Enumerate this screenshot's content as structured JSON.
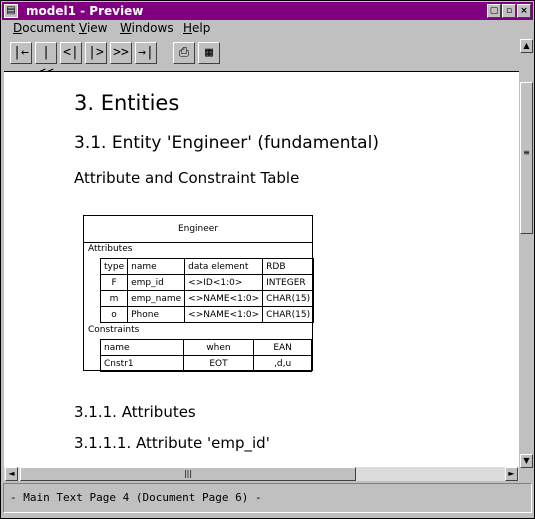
{
  "window": {
    "title": "model1 - Preview",
    "sys_icon": "▤",
    "min_icon": "▢",
    "restore_icon": "▫",
    "close_icon": "×"
  },
  "menu": [
    "Document",
    "View",
    "Windows",
    "Help"
  ],
  "toolbar": [
    {
      "name": "first-page-icon",
      "glyph": "|←"
    },
    {
      "name": "prev-page-fast-icon",
      "glyph": "|<<"
    },
    {
      "name": "prev-page-icon",
      "glyph": "<|"
    },
    {
      "name": "next-page-icon",
      "glyph": "|>"
    },
    {
      "name": "next-page-fast-icon",
      "glyph": ">>"
    },
    {
      "name": "last-page-icon",
      "glyph": "→|"
    },
    {
      "name": "print-icon",
      "glyph": "⎙"
    },
    {
      "name": "page-setup-icon",
      "glyph": "▦"
    }
  ],
  "document": {
    "h1": "3. Entities",
    "h2": "3.1. Entity 'Engineer' (fundamental)",
    "h3": "Attribute and Constraint Table",
    "entity_table": {
      "title": "Engineer",
      "attributes_label": "Attributes",
      "attr_headers": [
        "type",
        "name",
        "data element",
        "RDB"
      ],
      "attr_rows": [
        [
          "F",
          "emp_id",
          "<>ID<1:0>",
          "INTEGER"
        ],
        [
          "m",
          "emp_name",
          "<>NAME<1:0>",
          "CHAR(15)"
        ],
        [
          "o",
          "Phone",
          "<>NAME<1:0>",
          "CHAR(15)"
        ]
      ],
      "constraints_label": "Constraints",
      "con_headers": [
        "name",
        "when",
        "EAN"
      ],
      "con_rows": [
        [
          "Cnstr1",
          "EOT",
          ",d,u"
        ]
      ]
    },
    "h4a": "3.1.1. Attributes",
    "h4b": "3.1.1.1. Attribute 'emp_id'"
  },
  "scroll_icons": {
    "up": "▲",
    "down": "▼",
    "left": "◄",
    "right": "►",
    "grip_v": "≡",
    "grip_h": "|||"
  },
  "status": "- Main Text Page 4  (Document Page 6) -"
}
